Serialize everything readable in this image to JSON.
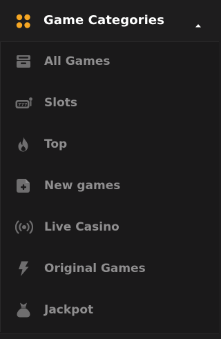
{
  "header": {
    "title": "Game Categories",
    "icon": "grid-dots-icon",
    "caret": "caret-up-icon",
    "accent": "#f5a623"
  },
  "items": [
    {
      "label": "All Games",
      "icon": "archive-box-icon"
    },
    {
      "label": "Slots",
      "icon": "slot-machine-icon"
    },
    {
      "label": "Top",
      "icon": "flame-icon"
    },
    {
      "label": "New games",
      "icon": "new-document-icon"
    },
    {
      "label": "Live Casino",
      "icon": "live-broadcast-icon"
    },
    {
      "label": "Original Games",
      "icon": "lightning-bolt-icon"
    },
    {
      "label": "Jackpot",
      "icon": "money-bag-icon"
    }
  ],
  "colors": {
    "background": "#1a191a",
    "text_primary": "#ffffff",
    "text_muted": "#8f8e8f",
    "icon_muted": "#6f6e6f"
  }
}
